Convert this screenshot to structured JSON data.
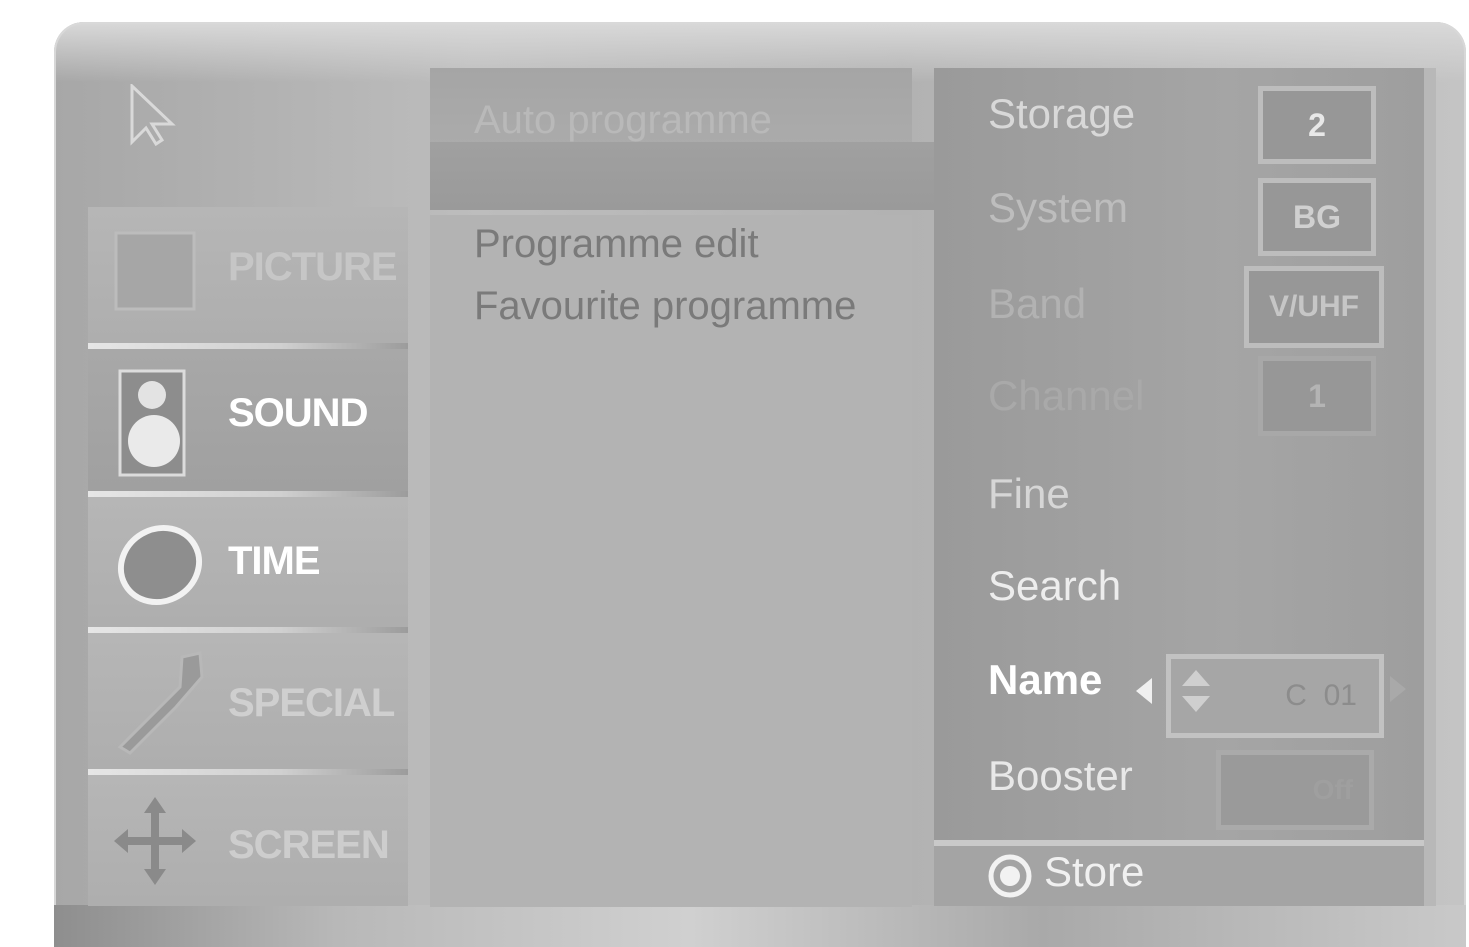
{
  "side_menu": {
    "items": [
      {
        "label": "PICTURE",
        "icon": "picture-icon"
      },
      {
        "label": "SOUND",
        "icon": "speaker-icon"
      },
      {
        "label": "TIME",
        "icon": "clock-icon"
      },
      {
        "label": "SPECIAL",
        "icon": "wrench-icon"
      },
      {
        "label": "SCREEN",
        "icon": "move-arrows-icon"
      }
    ],
    "selected": "SOUND"
  },
  "submenu": {
    "title": "Auto programme",
    "items": [
      "Programme edit",
      "Favourite programme"
    ]
  },
  "settings": {
    "storage": {
      "label": "Storage",
      "value": "2"
    },
    "system": {
      "label": "System",
      "value": "BG"
    },
    "band": {
      "label": "Band",
      "value": "V/UHF"
    },
    "channel": {
      "label": "Channel",
      "value": "1"
    },
    "fine": {
      "label": "Fine"
    },
    "search": {
      "label": "Search"
    },
    "name": {
      "label": "Name",
      "value": "C  01"
    },
    "booster": {
      "label": "Booster",
      "value": "Off"
    }
  },
  "footer": {
    "store_label": "Store"
  },
  "colors": {
    "selected_text": "#ffffff",
    "dim_text": "#c4c4c4"
  }
}
